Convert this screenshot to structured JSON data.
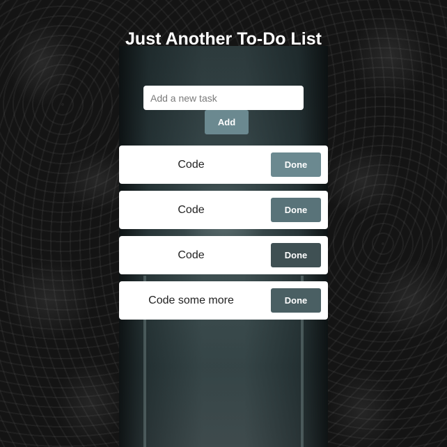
{
  "app": {
    "title": "Just Another To-Do List"
  },
  "form": {
    "input_placeholder": "Add a new task",
    "input_value": "",
    "add_label": "Add",
    "add_color": "#6b8990"
  },
  "tasks": [
    {
      "text": "Code",
      "done_label": "Done",
      "button_color": "#6b8990"
    },
    {
      "text": "Code",
      "done_label": "Done",
      "button_color": "#597379"
    },
    {
      "text": "Code",
      "done_label": "Done",
      "button_color": "#3f5053"
    },
    {
      "text": "Code some more",
      "done_label": "Done",
      "button_color": "#4a5f63"
    }
  ],
  "colors": {
    "page_background": "#141414",
    "card_background": "#ffffff",
    "title_text": "#ffffff"
  }
}
